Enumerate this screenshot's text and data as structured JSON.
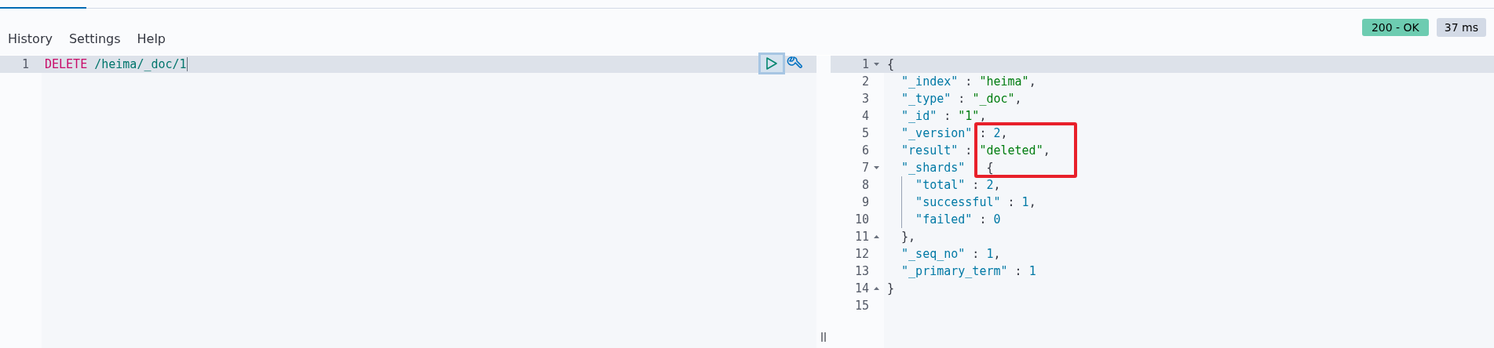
{
  "menu": [
    {
      "label": "History"
    },
    {
      "label": "Settings"
    },
    {
      "label": "Help"
    }
  ],
  "status": {
    "code": "200 - OK",
    "time": "37 ms"
  },
  "request": {
    "lines": [
      {
        "number": "1",
        "active": true,
        "tokens": [
          {
            "kind": "method",
            "text": "DELETE"
          },
          {
            "kind": "url",
            "text": " /heima/_doc/1"
          }
        ]
      }
    ]
  },
  "response": {
    "lines": [
      {
        "number": "1",
        "active": true,
        "fold_open": true,
        "fold_close": false,
        "guide": false,
        "tokens": [
          {
            "kind": "punct",
            "text": "{"
          }
        ]
      },
      {
        "number": "2",
        "active": false,
        "fold_open": false,
        "fold_close": false,
        "guide": false,
        "tokens": [
          {
            "kind": "key",
            "text": "  \"_index\""
          },
          {
            "kind": "punct",
            "text": " : "
          },
          {
            "kind": "string",
            "text": "\"heima\""
          },
          {
            "kind": "punct",
            "text": ","
          }
        ]
      },
      {
        "number": "3",
        "active": false,
        "fold_open": false,
        "fold_close": false,
        "guide": false,
        "tokens": [
          {
            "kind": "key",
            "text": "  \"_type\""
          },
          {
            "kind": "punct",
            "text": " : "
          },
          {
            "kind": "string",
            "text": "\"_doc\""
          },
          {
            "kind": "punct",
            "text": ","
          }
        ]
      },
      {
        "number": "4",
        "active": false,
        "fold_open": false,
        "fold_close": false,
        "guide": false,
        "tokens": [
          {
            "kind": "key",
            "text": "  \"_id\""
          },
          {
            "kind": "punct",
            "text": " : "
          },
          {
            "kind": "string",
            "text": "\"1\""
          },
          {
            "kind": "punct",
            "text": ","
          }
        ]
      },
      {
        "number": "5",
        "active": false,
        "fold_open": false,
        "fold_close": false,
        "guide": false,
        "tokens": [
          {
            "kind": "key",
            "text": "  \"_version\""
          },
          {
            "kind": "punct",
            "text": " : "
          },
          {
            "kind": "number",
            "text": "2"
          },
          {
            "kind": "punct",
            "text": ","
          }
        ]
      },
      {
        "number": "6",
        "active": false,
        "fold_open": false,
        "fold_close": false,
        "guide": false,
        "tokens": [
          {
            "kind": "key",
            "text": "  \"result\""
          },
          {
            "kind": "punct",
            "text": " : "
          },
          {
            "kind": "string",
            "text": "\"deleted\""
          },
          {
            "kind": "punct",
            "text": ","
          }
        ]
      },
      {
        "number": "7",
        "active": false,
        "fold_open": true,
        "fold_close": false,
        "guide": false,
        "tokens": [
          {
            "kind": "key",
            "text": "  \"_shards\""
          },
          {
            "kind": "punct",
            "text": "   {"
          }
        ]
      },
      {
        "number": "8",
        "active": false,
        "fold_open": false,
        "fold_close": false,
        "guide": true,
        "tokens": [
          {
            "kind": "key",
            "text": "    \"total\""
          },
          {
            "kind": "punct",
            "text": " : "
          },
          {
            "kind": "number",
            "text": "2"
          },
          {
            "kind": "punct",
            "text": ","
          }
        ]
      },
      {
        "number": "9",
        "active": false,
        "fold_open": false,
        "fold_close": false,
        "guide": true,
        "tokens": [
          {
            "kind": "key",
            "text": "    \"successful\""
          },
          {
            "kind": "punct",
            "text": " : "
          },
          {
            "kind": "number",
            "text": "1"
          },
          {
            "kind": "punct",
            "text": ","
          }
        ]
      },
      {
        "number": "10",
        "active": false,
        "fold_open": false,
        "fold_close": false,
        "guide": true,
        "tokens": [
          {
            "kind": "key",
            "text": "    \"failed\""
          },
          {
            "kind": "punct",
            "text": " : "
          },
          {
            "kind": "number",
            "text": "0"
          }
        ]
      },
      {
        "number": "11",
        "active": false,
        "fold_open": false,
        "fold_close": true,
        "guide": false,
        "tokens": [
          {
            "kind": "punct",
            "text": "  },"
          }
        ]
      },
      {
        "number": "12",
        "active": false,
        "fold_open": false,
        "fold_close": false,
        "guide": false,
        "tokens": [
          {
            "kind": "key",
            "text": "  \"_seq_no\""
          },
          {
            "kind": "punct",
            "text": " : "
          },
          {
            "kind": "number",
            "text": "1"
          },
          {
            "kind": "punct",
            "text": ","
          }
        ]
      },
      {
        "number": "13",
        "active": false,
        "fold_open": false,
        "fold_close": false,
        "guide": false,
        "tokens": [
          {
            "kind": "key",
            "text": "  \"_primary_term\""
          },
          {
            "kind": "punct",
            "text": " : "
          },
          {
            "kind": "number",
            "text": "1"
          }
        ]
      },
      {
        "number": "14",
        "active": false,
        "fold_open": false,
        "fold_close": true,
        "guide": false,
        "tokens": [
          {
            "kind": "punct",
            "text": "}"
          }
        ]
      },
      {
        "number": "15",
        "active": false,
        "fold_open": false,
        "fold_close": false,
        "guide": false
      }
    ]
  }
}
